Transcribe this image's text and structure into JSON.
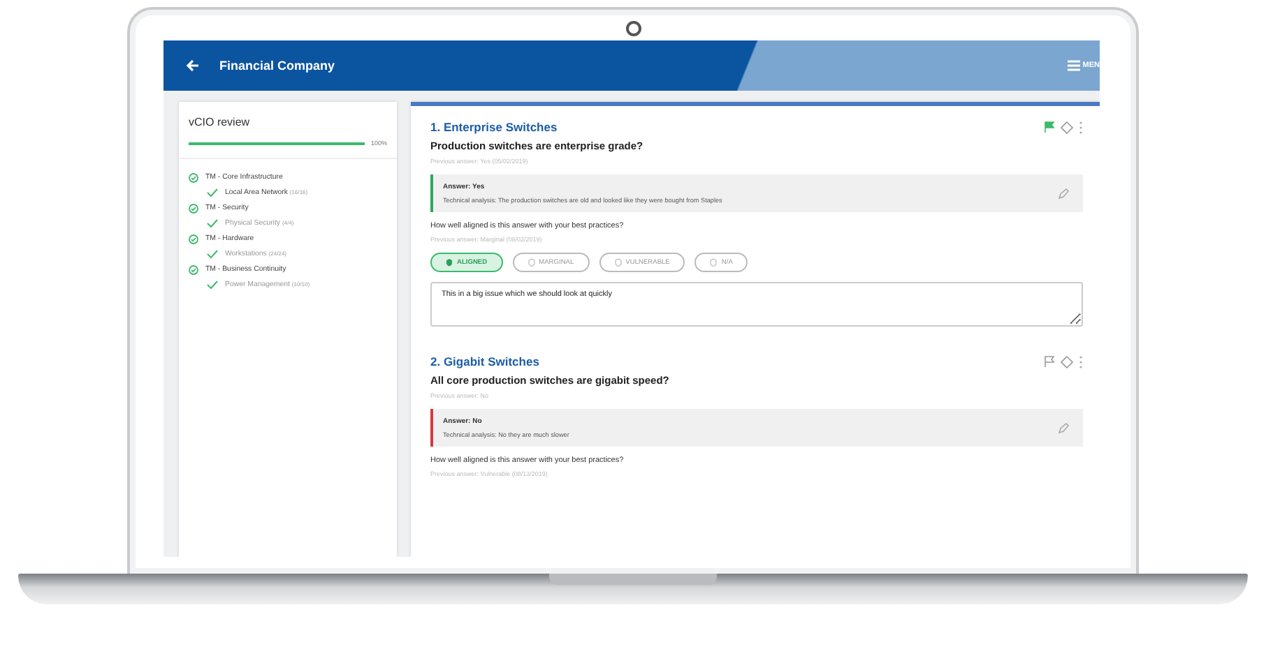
{
  "header": {
    "title": "Financial Company",
    "menu_label": "MEN"
  },
  "sidebar": {
    "title": "vCIO review",
    "progress": {
      "level": 1.0,
      "reading": "100%"
    },
    "groups": [
      {
        "label": "TM - Core Infrastructure",
        "children": [
          {
            "label": "Local Area Network",
            "count": "(16/16)",
            "done": true
          }
        ]
      },
      {
        "label": "TM - Security",
        "children": [
          {
            "label": "Physical Security",
            "count": "(4/4)",
            "done": true
          }
        ]
      },
      {
        "label": "TM - Hardware",
        "children": [
          {
            "label": "Workstations",
            "count": "(24/24)",
            "done": true
          }
        ]
      },
      {
        "label": "TM - Business Continuity",
        "children": [
          {
            "label": "Power Management",
            "count": "(10/10)",
            "done": true
          }
        ]
      }
    ]
  },
  "questions": [
    {
      "title": "1. Enterprise Switches",
      "flagged": true,
      "question": "Production switches are enterprise grade?",
      "previous": "Previous answer: Yes (05/02/2019)",
      "answer": {
        "kind": "positive",
        "label": "Answer: Yes",
        "analysis": "Technical analysis: The production switches are old and looked like they were bought from Staples"
      },
      "alignment_prompt": "How well aligned is this answer with your best practices?",
      "alignment_previous": "Previous answer: Marginal (08/02/2019)",
      "options": [
        {
          "label": "ALIGNED",
          "selected": true
        },
        {
          "label": "MARGINAL",
          "selected": false
        },
        {
          "label": "VULNERABLE",
          "selected": false
        },
        {
          "label": "N/A",
          "selected": false
        }
      ],
      "comment": "This in a big issue which we should look at quickly"
    },
    {
      "title": "2. Gigabit Switches",
      "flagged": false,
      "question": "All core production switches are gigabit speed?",
      "previous": "Previous answer: No",
      "answer": {
        "kind": "negative",
        "label": "Answer: No",
        "analysis": "Technical analysis: No they are much slower"
      },
      "alignment_prompt": "How well aligned is this answer with your best practices?",
      "alignment_previous": "Previous answer: Vulnerable (08/13/2019)"
    }
  ]
}
